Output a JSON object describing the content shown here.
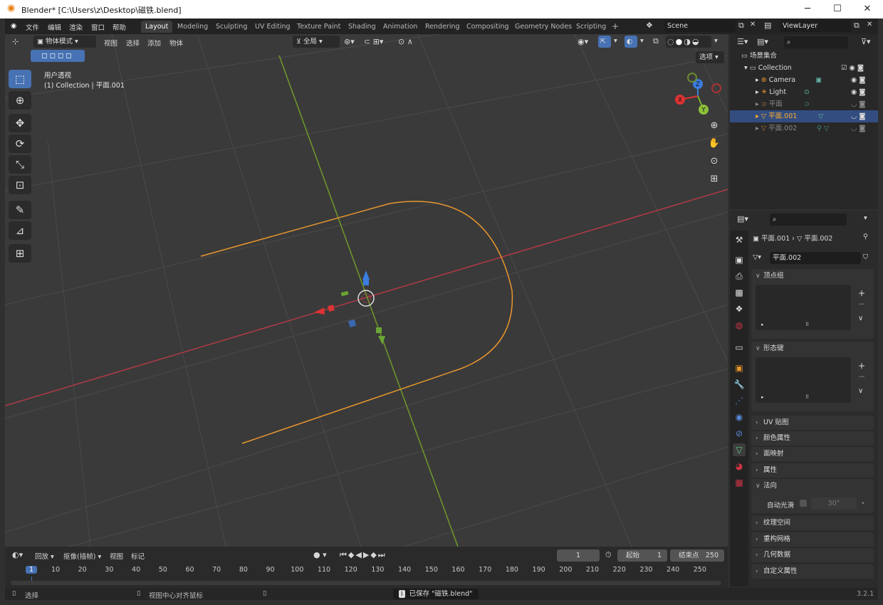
{
  "window": {
    "title": "Blender* [C:\\Users\\z\\Desktop\\磁铁.blend]",
    "minimize": "─",
    "maximize": "☐",
    "close": "✕"
  },
  "topmenu": [
    "文件",
    "编辑",
    "渲染",
    "窗口",
    "帮助"
  ],
  "workspaces": [
    "Layout",
    "Modeling",
    "Sculpting",
    "UV Editing",
    "Texture Paint",
    "Shading",
    "Animation",
    "Rendering",
    "Compositing",
    "Geometry Nodes",
    "Scripting",
    "+"
  ],
  "scene": "Scene",
  "viewlayer": "ViewLayer",
  "viewport": {
    "mode": "物体模式",
    "menus": [
      "视图",
      "选择",
      "添加",
      "物体"
    ],
    "orientation": "全局",
    "options": "选项",
    "view_name": "用户透视",
    "view_info": "(1) Collection | 平面.001",
    "accent": "#4772b3"
  },
  "gizmo": {
    "x": "X",
    "y": "Y",
    "z": "Z"
  },
  "outliner": {
    "root": "场景集合",
    "items": [
      {
        "name": "Collection"
      },
      {
        "name": "Camera"
      },
      {
        "name": "Light"
      },
      {
        "name": "平面"
      },
      {
        "name": "平面.001",
        "selected": true
      },
      {
        "name": "平面.002"
      }
    ]
  },
  "properties": {
    "breadcrumb_obj": "平面.001",
    "breadcrumb_data": "平面.002",
    "data_name": "平面.002",
    "panels": [
      "顶点组",
      "形态键",
      "UV 贴图",
      "颜色属性",
      "面映射",
      "属性",
      "法向",
      "纹理空间",
      "重构网格",
      "几何数据",
      "自定义属性"
    ],
    "auto_smooth_label": "自动光滑",
    "auto_smooth_angle": "30°"
  },
  "timeline": {
    "menus": [
      "回放",
      "抠像(插帧)",
      "视图",
      "标记"
    ],
    "current_frame": "1",
    "start_label": "起始",
    "start": "1",
    "end_label": "结束点",
    "end": "250",
    "ruler": [
      "1",
      "10",
      "20",
      "30",
      "40",
      "50",
      "60",
      "70",
      "80",
      "90",
      "100",
      "110",
      "120",
      "130",
      "140",
      "150",
      "160",
      "170",
      "180",
      "190",
      "200",
      "210",
      "220",
      "230",
      "240",
      "250"
    ]
  },
  "status": {
    "select": "选择",
    "center": "视图中心对齐鼠标",
    "saved": "已保存 \"磁铁.blend\"",
    "version": "3.2.1"
  }
}
